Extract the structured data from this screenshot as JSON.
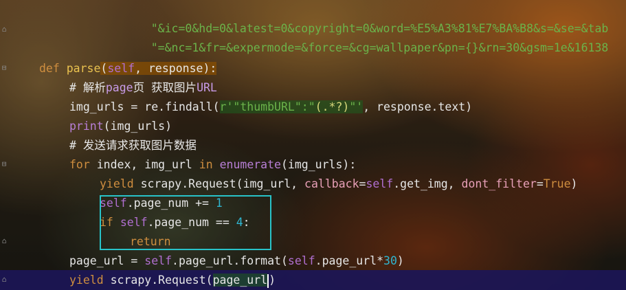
{
  "code": {
    "line_url_1": "\"&ic=0&hd=0&latest=0&copyright=0&word=%E5%A3%81%E7%BA%B8&s=&se=&tab",
    "line_url_2": "\"=&nc=1&fr=&expermode=&force=&cg=wallpaper&pn={}&rn=30&gsm=1e&16138",
    "def_kw": "def",
    "def_name": "parse",
    "def_params_open": "(",
    "def_self": "self",
    "def_params_rest": ", response):",
    "comment1_hash": "# ",
    "comment1_text_a": "解析",
    "comment1_kw": "page",
    "comment1_text_b": "页 获取图片",
    "comment1_kw2": "URL",
    "findall_lhs": "img_urls = re.findall(",
    "findall_prefix": "r'",
    "findall_str_a": "\"thumbURL\":\"",
    "findall_regex": "(.*?)",
    "findall_str_b": "\"'",
    "findall_rest": ", response.text)",
    "print_fn": "print",
    "print_rest": "(img_urls)",
    "comment2_hash": "# ",
    "comment2_text": "发送请求获取图片数据",
    "for_kw": "for",
    "for_mid": " index, img_url ",
    "in_kw": "in",
    "enumerate_fn": "enumerate",
    "for_rest": "(img_urls):",
    "yield_kw": "yield",
    "yield1_rest_a": " scrapy.Request(img_url, ",
    "callback_param": "callback",
    "yield1_eq": "=",
    "yield1_self": "self",
    "yield1_mid": ".get_img, ",
    "dont_filter_param": "dont_filter",
    "yield1_eq2": "=",
    "true_kw": "True",
    "yield1_end": ")",
    "pn_self": "self",
    "pn_rest": ".page_num += ",
    "pn_num": "1",
    "if_kw": "if",
    "if_self": "self",
    "if_rest": ".page_num ",
    "if_op": "==",
    "if_sp": " ",
    "if_num": "4",
    "if_colon": ":",
    "return_kw": "return",
    "pageurl_lhs": "page_url = ",
    "pageurl_self": "self",
    "pageurl_mid": ".page_url.format(",
    "pageurl_self2": "self",
    "pageurl_mid2": ".page_url*",
    "pageurl_num": "30",
    "pageurl_end": ")",
    "yield2_kw": "yield",
    "yield2_rest": " scrapy.Request(",
    "yield2_arg": "page_url",
    "yield2_end": ")"
  },
  "colors": {
    "selection_box": "#28c3c9",
    "caret_line": "#1c1656"
  }
}
